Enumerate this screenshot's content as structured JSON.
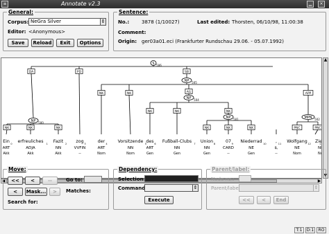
{
  "window": {
    "title": "Annotate v2.3"
  },
  "general": {
    "legend": "General:",
    "corpus_label": "Corpus:",
    "corpus_value": "NeGra Silver",
    "editor_label": "Editor:",
    "editor_value": "<Anonymous>",
    "buttons": {
      "save": "Save",
      "reload": "Reload",
      "exit": "Exit",
      "options": "Options"
    }
  },
  "sentence": {
    "legend": "Sentence:",
    "no_label": "No.:",
    "no_value": "3878 (1/10027)",
    "last_edited_label": "Last edited:",
    "last_edited_value": "Thorsten, 06/10/98, 11:00:38",
    "comment_label": "Comment:",
    "comment_value": "",
    "origin_label": "Origin:",
    "origin_value": "ger03a01.eci (Frankfurter Rundschau 29.06. - 05.07.1992)"
  },
  "tree": {
    "nodes": [
      {
        "id": "S",
        "label": "S",
        "num": "506"
      },
      {
        "id": "NP1",
        "label": "NP",
        "num": "505"
      },
      {
        "id": "NP2",
        "label": "NP",
        "num": "504"
      },
      {
        "id": "NP3",
        "label": "NP",
        "num": "500"
      },
      {
        "id": "NP4",
        "label": "NP",
        "num": "501"
      },
      {
        "id": "MPN",
        "label": "MPN",
        "num": "502"
      }
    ],
    "edges": {
      "da": "DA",
      "pd": "PD",
      "sb": "SB",
      "nk_a": "NK",
      "nk_b": "NK",
      "nk_c": "NK",
      "nk_d": "NK",
      "nk_e": "NK",
      "nk_f": "NK",
      "nk_g": "NK",
      "nk_h": "NK",
      "nk_i": "NK",
      "nk_j": "NK",
      "ag": "AG",
      "app": "APP",
      "pnc_a": "PNC",
      "pnc_b": "PNC"
    },
    "tokens": [
      {
        "word": "Ein",
        "idx": "0",
        "pos": "ART",
        "morph": "Akk"
      },
      {
        "word": "erfreuliches",
        "idx": "1",
        "pos": "ADJA",
        "morph": "Akk"
      },
      {
        "word": "Fazit",
        "idx": "2",
        "pos": "NN",
        "morph": "Akk"
      },
      {
        "word": "zog",
        "idx": "3",
        "pos": "VVFIN",
        "morph": "--"
      },
      {
        "word": "der",
        "idx": "4",
        "pos": "ART",
        "morph": "Nom"
      },
      {
        "word": "Vorsitzende",
        "idx": "5",
        "pos": "NN",
        "morph": "Nom"
      },
      {
        "word": "des",
        "idx": "6",
        "pos": "ART",
        "morph": "Gen"
      },
      {
        "word": "Fußball-Clubs",
        "idx": "7",
        "pos": "NN",
        "morph": "Gen"
      },
      {
        "word": "Union",
        "idx": "8",
        "pos": "NN",
        "morph": "Gen"
      },
      {
        "word": "07",
        "idx": "9",
        "pos": "CARD",
        "morph": "--"
      },
      {
        "word": "Niederrad",
        "idx": "10",
        "pos": "NE",
        "morph": "Gen"
      },
      {
        "word": ",",
        "idx": "11",
        "pos": "$,",
        "morph": "--"
      },
      {
        "word": "Wolfgang",
        "idx": "12",
        "pos": "NE",
        "morph": "Nom"
      },
      {
        "word": "Zie",
        "idx": "13",
        "pos": "NE",
        "morph": "Nom"
      }
    ]
  },
  "move": {
    "legend": "Move:",
    "btn_first": "<<",
    "btn_prev": "<",
    "btn_disabled_a": "--",
    "btn_disabled_b": ">",
    "btn_mask": "Mask...",
    "go_to_label": "Go to:",
    "matches_label": "Matches:",
    "search_for_label": "Search for:"
  },
  "dependency": {
    "legend": "Dependency:",
    "selection_label": "Selection:",
    "command_label": "Command:",
    "execute_label": "Execute"
  },
  "parent_label": {
    "legend": "Parent/label:",
    "node_no_label": "Node no.:",
    "parent_label_label": "Parent/label:",
    "btn_first": "<<",
    "btn_prev": "<",
    "btn_end": "End"
  },
  "statusbar": {
    "t": "T:1",
    "d": "D:1",
    "mode": "RO"
  }
}
